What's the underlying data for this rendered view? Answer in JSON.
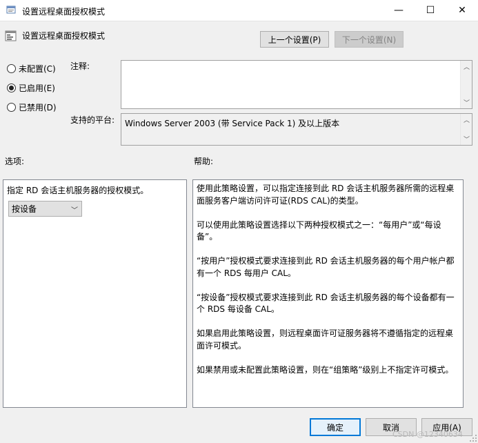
{
  "window": {
    "title": "设置远程桌面授权模式",
    "minimize": "—",
    "maximize": "☐",
    "close": "✕"
  },
  "policy_title": "设置远程桌面授权模式",
  "nav": {
    "prev_label": "上一个设置(P)",
    "next_label": "下一个设置(N)"
  },
  "state": {
    "options": [
      {
        "label": "未配置(C)",
        "selected": false
      },
      {
        "label": "已启用(E)",
        "selected": true
      },
      {
        "label": "已禁用(D)",
        "selected": false
      }
    ]
  },
  "comment": {
    "label": "注释:",
    "value": ""
  },
  "platform": {
    "label": "支持的平台:",
    "value": "Windows Server 2003 (带 Service Pack 1) 及以上版本"
  },
  "options_section": {
    "heading": "选项:",
    "description": "指定 RD 会话主机服务器的授权模式。",
    "mode_selected": "按设备"
  },
  "help_section": {
    "heading": "帮助:",
    "paragraphs": [
      "使用此策略设置，可以指定连接到此 RD 会话主机服务器所需的远程桌面服务客户端访问许可证(RDS CAL)的类型。",
      "可以使用此策略设置选择以下两种授权模式之一：“每用户”或“每设备”。",
      "“按用户”授权模式要求连接到此 RD 会话主机服务器的每个用户帐户都有一个 RDS 每用户 CAL。",
      "“按设备”授权模式要求连接到此 RD 会话主机服务器的每个设备都有一个 RDS 每设备 CAL。",
      "如果启用此策略设置，则远程桌面许可证服务器将不遵循指定的远程桌面许可模式。",
      "如果禁用或未配置此策略设置，则在“组策略”级别上不指定许可模式。"
    ]
  },
  "footer": {
    "ok_label": "确定",
    "cancel_label": "取消",
    "apply_label": "应用(A)"
  },
  "watermark": "CSDN @12340634"
}
